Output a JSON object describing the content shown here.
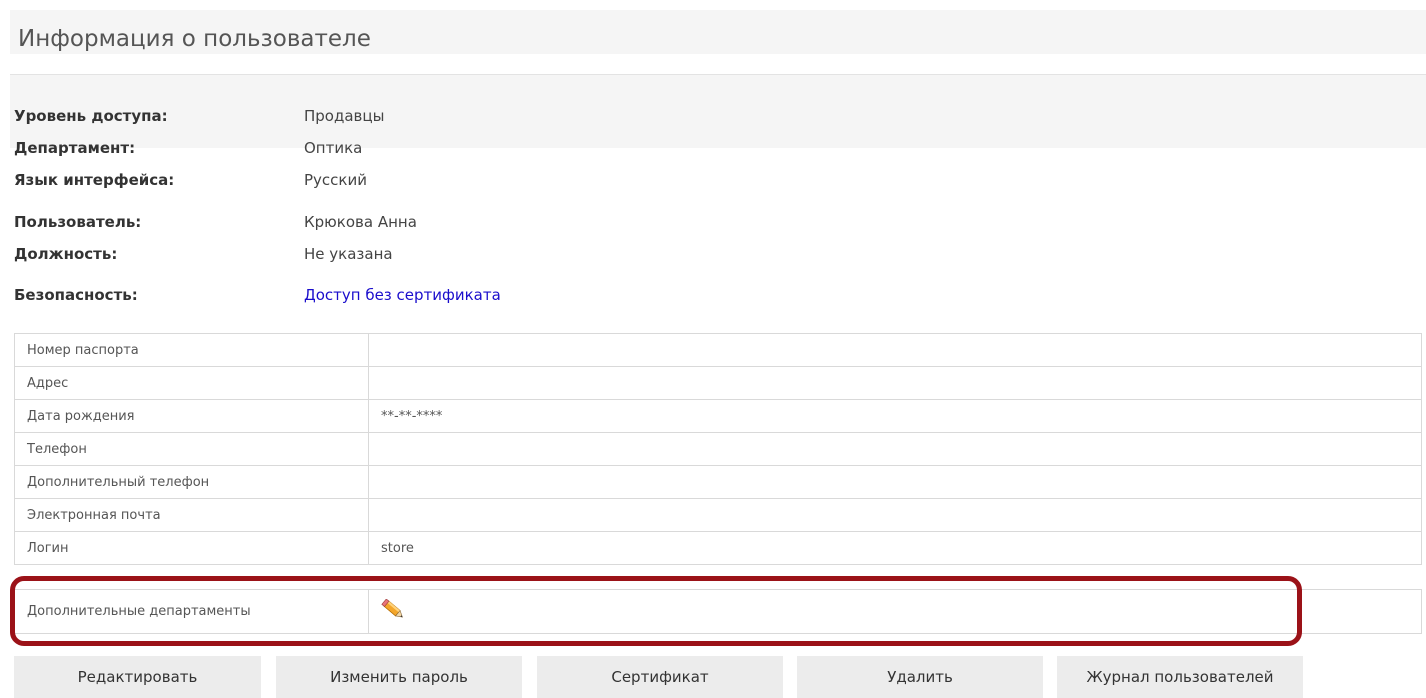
{
  "page": {
    "title": "Информация о пользователе"
  },
  "info": {
    "access_level": {
      "label": "Уровень доступа:",
      "value": "Продавцы"
    },
    "department": {
      "label": "Департамент:",
      "value": "Оптика"
    },
    "language": {
      "label": "Язык интерфейса:",
      "value": "Русский"
    },
    "user": {
      "label": "Пользователь:",
      "value": "Крюкова Анна"
    },
    "position": {
      "label": "Должность:",
      "value": "Не указана"
    },
    "security": {
      "label": "Безопасность:",
      "value": "Доступ без сертификата"
    }
  },
  "details": {
    "rows": [
      {
        "label": "Номер паспорта",
        "value": ""
      },
      {
        "label": "Адрес",
        "value": ""
      },
      {
        "label": "Дата рождения",
        "value": "**-**-****"
      },
      {
        "label": "Телефон",
        "value": ""
      },
      {
        "label": "Дополнительный телефон",
        "value": ""
      },
      {
        "label": "Электронная почта",
        "value": ""
      },
      {
        "label": "Логин",
        "value": "store"
      }
    ]
  },
  "extra": {
    "label": "Дополнительные департаменты",
    "edit_icon": "pencil-icon"
  },
  "buttons": {
    "edit": "Редактировать",
    "change_password": "Изменить пароль",
    "certificate": "Сертификат",
    "delete": "Удалить",
    "users_log": "Журнал пользователей"
  },
  "colors": {
    "link": "#1a0dcc",
    "highlight": "#9b1218",
    "button_bg": "#ececec"
  }
}
